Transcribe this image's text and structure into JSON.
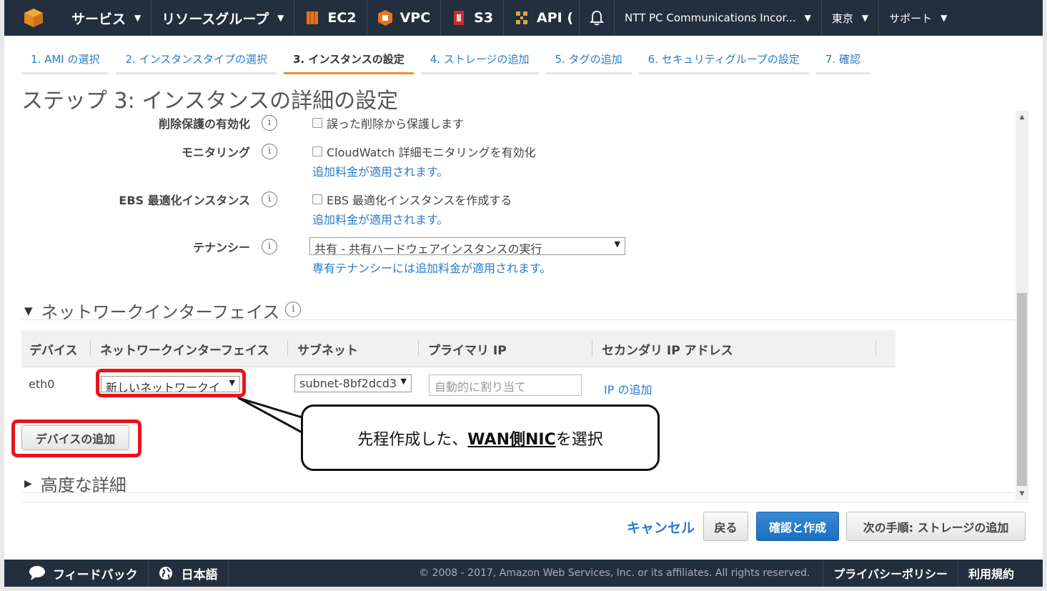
{
  "topnav": {
    "services": "サービス",
    "resource_groups": "リソースグループ",
    "ec2": "EC2",
    "vpc": "VPC",
    "s3": "S3",
    "api": "API (",
    "account": "NTT PC Communications Incor...",
    "region": "東京",
    "support": "サポート"
  },
  "tabs": [
    {
      "label": "1. AMI の選択"
    },
    {
      "label": "2. インスタンスタイプの選択"
    },
    {
      "label": "3. インスタンスの設定"
    },
    {
      "label": "4. ストレージの追加"
    },
    {
      "label": "5. タグの追加"
    },
    {
      "label": "6. セキュリティグループの設定"
    },
    {
      "label": "7. 確認"
    }
  ],
  "page_title": "ステップ 3: インスタンスの詳細の設定",
  "settings": {
    "termination": {
      "label": "削除保護の有効化",
      "checkbox": "誤った削除から保護します"
    },
    "monitoring": {
      "label": "モニタリング",
      "checkbox": "CloudWatch 詳細モニタリングを有効化",
      "note": "追加料金が適用されます。"
    },
    "ebs": {
      "label": "EBS 最適化インスタンス",
      "checkbox": "EBS 最適化インスタンスを作成する",
      "note": "追加料金が適用されます。"
    },
    "tenancy": {
      "label": "テナンシー",
      "value": "共有 - 共有ハードウェアインスタンスの実行",
      "note": "専有テナンシーには追加料金が適用されます。"
    },
    "info": "i"
  },
  "network": {
    "heading": "ネットワークインターフェイス",
    "columns": [
      "デバイス",
      "ネットワークインターフェイス",
      "サブネット",
      "プライマリ IP",
      "セカンダリ IP アドレス"
    ],
    "row": {
      "device": "eth0",
      "interface": "新しいネットワークイ",
      "subnet": "subnet-8bf2dcd3",
      "primary_ip_placeholder": "自動的に割り当て",
      "add_ip": "IP の追加"
    },
    "add_device": "デバイスの追加"
  },
  "callout": {
    "prefix": "先程作成した、",
    "emph": "WAN側NIC",
    "suffix": "を選択"
  },
  "advanced": "高度な詳細",
  "actions": {
    "cancel": "キャンセル",
    "back": "戻る",
    "review": "確認と作成",
    "next": "次の手順: ストレージの追加"
  },
  "footer": {
    "feedback": "フィードバック",
    "language": "日本語",
    "copyright": "© 2008 - 2017, Amazon Web Services, Inc. or its affiliates. All rights reserved.",
    "privacy": "プライバシーポリシー",
    "terms": "利用規約"
  },
  "colors": {
    "nav_bg": "#232f3e",
    "link": "#2a7ac9",
    "accent": "#ec912d",
    "highlight": "#e8141c",
    "primary": "#1a6fc0"
  }
}
